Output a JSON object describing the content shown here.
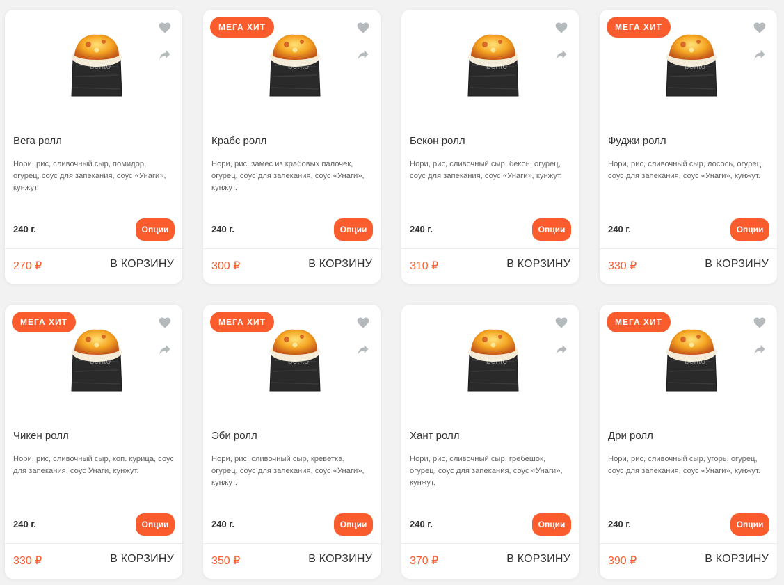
{
  "colors": {
    "accent": "#fa5c2d",
    "icon": "#b4b9bb"
  },
  "cards": [
    {
      "title": "Вега ролл",
      "badge": "",
      "description": "Нори, рис, сливочный сыр, помидор, огурец, соус для запекания, соус «Унаги», кунжут.",
      "weight": "240 г.",
      "options_label": "Опции",
      "price": "270 ₽",
      "cart_label": "В КОРЗИНУ",
      "watermark": "bento"
    },
    {
      "title": "Крабс ролл",
      "badge": "МЕГА ХИТ",
      "description": "Нори, рис, замес из крабовых палочек, огурец, соус для запекания, соус «Унаги», кунжут.",
      "weight": "240 г.",
      "options_label": "Опции",
      "price": "300 ₽",
      "cart_label": "В КОРЗИНУ",
      "watermark": "bento"
    },
    {
      "title": "Бекон ролл",
      "badge": "",
      "description": "Нори, рис, сливочный сыр, бекон, огурец, соус для запекания, соус «Унаги», кунжут.",
      "weight": "240 г.",
      "options_label": "Опции",
      "price": "310 ₽",
      "cart_label": "В КОРЗИНУ",
      "watermark": "bento"
    },
    {
      "title": "Фуджи ролл",
      "badge": "МЕГА ХИТ",
      "description": "Нори, рис, сливочный сыр, лосось, огурец, соус для запекания, соус «Унаги», кунжут.",
      "weight": "240 г.",
      "options_label": "Опции",
      "price": "330 ₽",
      "cart_label": "В КОРЗИНУ",
      "watermark": "bento"
    },
    {
      "title": "Чикен ролл",
      "badge": "МЕГА ХИТ",
      "description": "Нори, рис, сливочный сыр, коп. курица, соус для запекания, соус Унаги, кунжут.",
      "weight": "240 г.",
      "options_label": "Опции",
      "price": "330 ₽",
      "cart_label": "В КОРЗИНУ",
      "watermark": "bento"
    },
    {
      "title": "Эби ролл",
      "badge": "МЕГА ХИТ",
      "description": "Нори, рис, сливочный сыр, креветка, огурец, соус для запекания, соус «Унаги», кунжут.",
      "weight": "240 г.",
      "options_label": "Опции",
      "price": "350 ₽",
      "cart_label": "В КОРЗИНУ",
      "watermark": "bento"
    },
    {
      "title": "Хант ролл",
      "badge": "",
      "description": "Нори, рис, сливочный сыр, гребешок, огурец, соус для запекания, соус «Унаги», кунжут.",
      "weight": "240 г.",
      "options_label": "Опции",
      "price": "370 ₽",
      "cart_label": "В КОРЗИНУ",
      "watermark": "bento"
    },
    {
      "title": "Дри ролл",
      "badge": "МЕГА ХИТ",
      "description": "Нори, рис, сливочный сыр, угорь, огурец, соус для запекания, соус «Унаги», кунжут.",
      "weight": "240 г.",
      "options_label": "Опции",
      "price": "390 ₽",
      "cart_label": "В КОРЗИНУ",
      "watermark": "bento"
    }
  ]
}
